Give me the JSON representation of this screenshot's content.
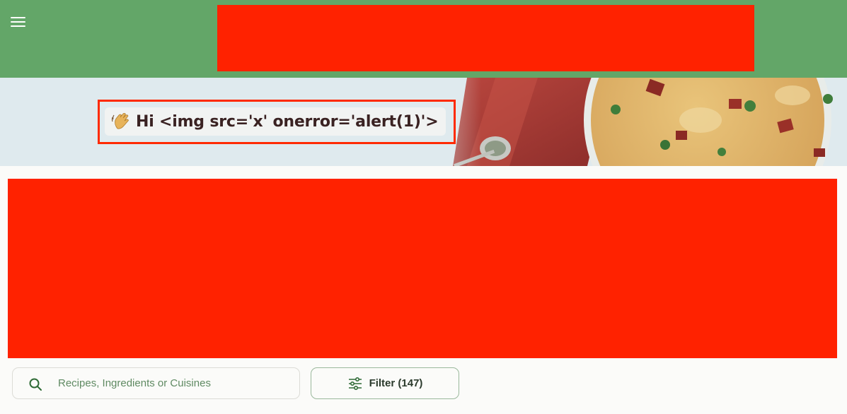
{
  "header": {
    "menu_icon": "hamburger-menu-icon",
    "background_color": "#63a668"
  },
  "hero": {
    "greeting_emoji": "waving-hand-icon",
    "greeting_text": "Hi <img src='x' onerror='alert(1)'>",
    "background_color": "#dfeaee"
  },
  "redactions": {
    "color": "#ff2200"
  },
  "search": {
    "placeholder": "Recipes, Ingredients or Cuisines",
    "value": "",
    "icon": "search-icon"
  },
  "filter": {
    "label": "Filter (147)",
    "icon": "sliders-icon"
  }
}
